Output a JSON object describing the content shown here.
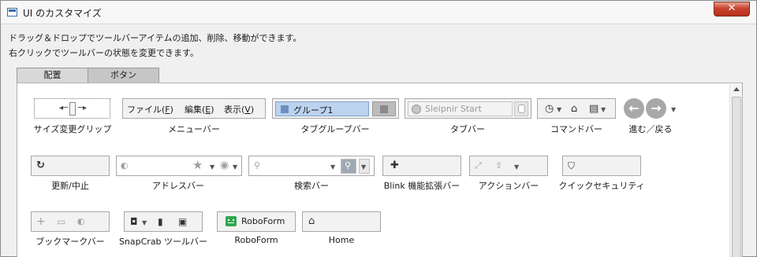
{
  "window": {
    "title": "UI のカスタマイズ",
    "close_glyph": "✕"
  },
  "description": {
    "line1": "ドラッグ＆ドロップでツールバーアイテムの追加、削除、移動ができます。",
    "line2": "右クリックでツールバーの状態を変更できます。"
  },
  "tabs": [
    {
      "label": "配置"
    },
    {
      "label": "ボタン"
    }
  ],
  "items": {
    "size_grip": {
      "label": "サイズ変更グリップ"
    },
    "menu_bar": {
      "label": "メニューバー",
      "menus": [
        {
          "text": "ファイル(",
          "key": "F",
          "tail": ")"
        },
        {
          "text": "編集(",
          "key": "E",
          "tail": ")"
        },
        {
          "text": "表示(",
          "key": "V",
          "tail": ")"
        }
      ]
    },
    "tab_group_bar": {
      "label": "タブグループバー",
      "group_name": "グループ1"
    },
    "tab_bar": {
      "label": "タブバー",
      "tab_title": "Sleipnir Start"
    },
    "command_bar": {
      "label": "コマンドバー"
    },
    "nav": {
      "label": "進む／戻る"
    },
    "refresh": {
      "label": "更新/中止"
    },
    "address_bar": {
      "label": "アドレスバー"
    },
    "search_bar": {
      "label": "検索バー"
    },
    "blink": {
      "label": "Blink 機能拡張バー"
    },
    "action_bar": {
      "label": "アクションバー"
    },
    "quick_security": {
      "label": "クイックセキュリティ"
    },
    "bookmark_bar": {
      "label": "ブックマークバー"
    },
    "snapcrab": {
      "label": "SnapCrab ツールバー"
    },
    "roboform": {
      "label": "RoboForm",
      "button_text": "RoboForm"
    },
    "home": {
      "label": "Home"
    }
  },
  "icons": {
    "refresh": "refresh-icon",
    "star": "star-icon",
    "home": "home-icon",
    "history": "history-icon",
    "page": "page-icon",
    "puzzle": "puzzle-icon",
    "shield": "shield-icon",
    "camera": "camera-icon",
    "plus": "plus-icon",
    "folder": "folder-icon",
    "search": "search-icon"
  },
  "colors": {
    "close_red": "#c7432e",
    "tab_group_blue": "#bcd3ee",
    "roboform_green": "#2fa84f"
  }
}
